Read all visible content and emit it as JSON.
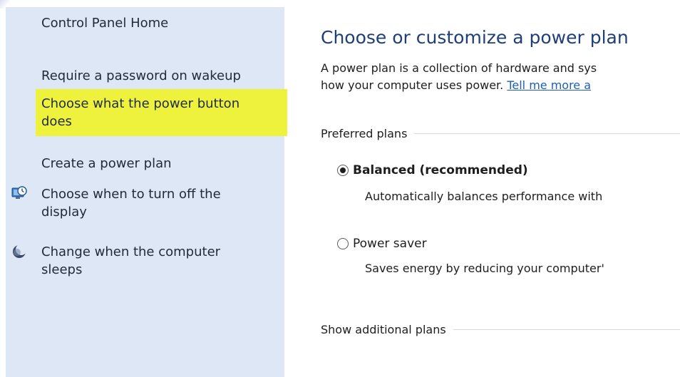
{
  "sidebar": {
    "items": [
      {
        "label": "Control Panel Home"
      },
      {
        "label": "Require a password on wakeup"
      },
      {
        "label_line1": "Choose what the power button",
        "label_line2": "does"
      },
      {
        "label": "Create a power plan"
      },
      {
        "label_line1": "Choose when to turn off the",
        "label_line2": "display",
        "icon": "display-clock-icon"
      },
      {
        "label_line1": "Change when the computer",
        "label_line2": "sleeps",
        "icon": "moon-sleep-icon"
      }
    ],
    "highlight_color": "#eef23c",
    "background_color": "#dde7f6"
  },
  "main": {
    "title": "Choose or customize a power plan",
    "description_line1": "A power plan is a collection of hardware and sys",
    "description_line2_prefix": "how your computer uses power. ",
    "description_link": "Tell me more a",
    "preferred_plans_header": "Preferred plans",
    "plans": [
      {
        "name": "Balanced (recommended)",
        "selected": true,
        "description": "Automatically balances performance with"
      },
      {
        "name": "Power saver",
        "selected": false,
        "description": "Saves energy by reducing your computer'"
      }
    ],
    "additional_plans_header": "Show additional plans",
    "title_color": "#1e3f7a",
    "link_color": "#1d5fb8"
  }
}
